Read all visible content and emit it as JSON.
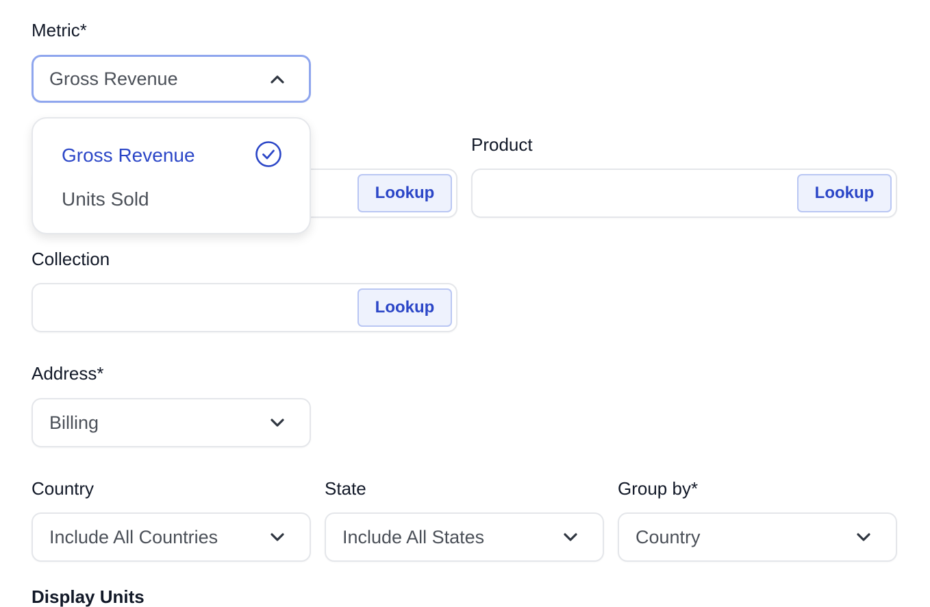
{
  "metric": {
    "label": "Metric*",
    "value": "Gross Revenue",
    "options": [
      {
        "label": "Gross Revenue",
        "selected": true
      },
      {
        "label": "Units Sold",
        "selected": false
      }
    ]
  },
  "product": {
    "label": "Product",
    "button": "Lookup",
    "value": ""
  },
  "hidden_field": {
    "button": "Lookup",
    "value": ""
  },
  "collection": {
    "label": "Collection",
    "button": "Lookup",
    "value": ""
  },
  "address": {
    "label": "Address*",
    "value": "Billing"
  },
  "country": {
    "label": "Country",
    "value": "Include All Countries"
  },
  "state": {
    "label": "State",
    "value": "Include All States"
  },
  "group_by": {
    "label": "Group by*",
    "value": "Country"
  },
  "next_section": {
    "label": "Display Units"
  },
  "colors": {
    "accent": "#2b46c7",
    "focus_border": "#8fa6ee",
    "button_bg": "#eef2fd"
  }
}
